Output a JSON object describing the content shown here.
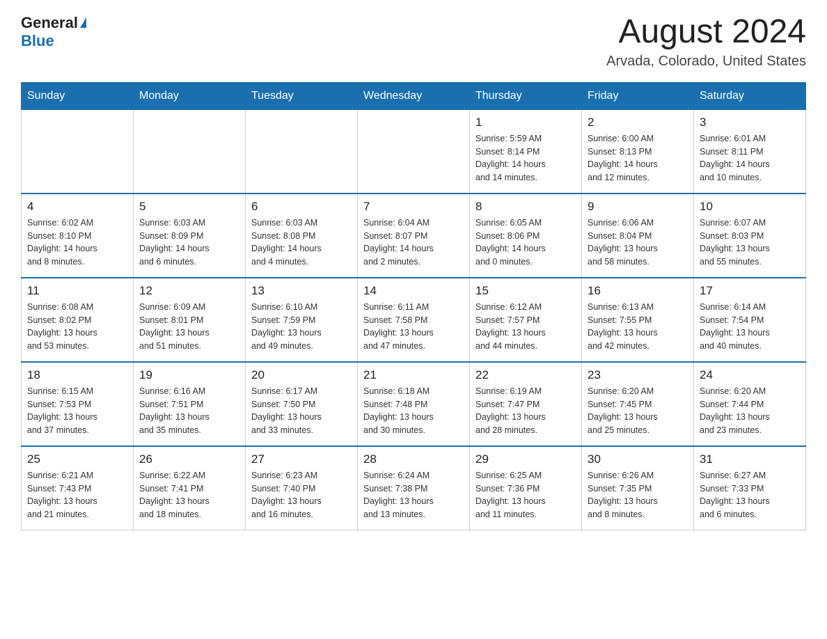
{
  "header": {
    "logo_general": "General",
    "logo_blue": "Blue",
    "month_title": "August 2024",
    "location": "Arvada, Colorado, United States"
  },
  "weekdays": [
    "Sunday",
    "Monday",
    "Tuesday",
    "Wednesday",
    "Thursday",
    "Friday",
    "Saturday"
  ],
  "weeks": [
    [
      {
        "day": "",
        "info": ""
      },
      {
        "day": "",
        "info": ""
      },
      {
        "day": "",
        "info": ""
      },
      {
        "day": "",
        "info": ""
      },
      {
        "day": "1",
        "info": "Sunrise: 5:59 AM\nSunset: 8:14 PM\nDaylight: 14 hours\nand 14 minutes."
      },
      {
        "day": "2",
        "info": "Sunrise: 6:00 AM\nSunset: 8:13 PM\nDaylight: 14 hours\nand 12 minutes."
      },
      {
        "day": "3",
        "info": "Sunrise: 6:01 AM\nSunset: 8:11 PM\nDaylight: 14 hours\nand 10 minutes."
      }
    ],
    [
      {
        "day": "4",
        "info": "Sunrise: 6:02 AM\nSunset: 8:10 PM\nDaylight: 14 hours\nand 8 minutes."
      },
      {
        "day": "5",
        "info": "Sunrise: 6:03 AM\nSunset: 8:09 PM\nDaylight: 14 hours\nand 6 minutes."
      },
      {
        "day": "6",
        "info": "Sunrise: 6:03 AM\nSunset: 8:08 PM\nDaylight: 14 hours\nand 4 minutes."
      },
      {
        "day": "7",
        "info": "Sunrise: 6:04 AM\nSunset: 8:07 PM\nDaylight: 14 hours\nand 2 minutes."
      },
      {
        "day": "8",
        "info": "Sunrise: 6:05 AM\nSunset: 8:06 PM\nDaylight: 14 hours\nand 0 minutes."
      },
      {
        "day": "9",
        "info": "Sunrise: 6:06 AM\nSunset: 8:04 PM\nDaylight: 13 hours\nand 58 minutes."
      },
      {
        "day": "10",
        "info": "Sunrise: 6:07 AM\nSunset: 8:03 PM\nDaylight: 13 hours\nand 55 minutes."
      }
    ],
    [
      {
        "day": "11",
        "info": "Sunrise: 6:08 AM\nSunset: 8:02 PM\nDaylight: 13 hours\nand 53 minutes."
      },
      {
        "day": "12",
        "info": "Sunrise: 6:09 AM\nSunset: 8:01 PM\nDaylight: 13 hours\nand 51 minutes."
      },
      {
        "day": "13",
        "info": "Sunrise: 6:10 AM\nSunset: 7:59 PM\nDaylight: 13 hours\nand 49 minutes."
      },
      {
        "day": "14",
        "info": "Sunrise: 6:11 AM\nSunset: 7:58 PM\nDaylight: 13 hours\nand 47 minutes."
      },
      {
        "day": "15",
        "info": "Sunrise: 6:12 AM\nSunset: 7:57 PM\nDaylight: 13 hours\nand 44 minutes."
      },
      {
        "day": "16",
        "info": "Sunrise: 6:13 AM\nSunset: 7:55 PM\nDaylight: 13 hours\nand 42 minutes."
      },
      {
        "day": "17",
        "info": "Sunrise: 6:14 AM\nSunset: 7:54 PM\nDaylight: 13 hours\nand 40 minutes."
      }
    ],
    [
      {
        "day": "18",
        "info": "Sunrise: 6:15 AM\nSunset: 7:53 PM\nDaylight: 13 hours\nand 37 minutes."
      },
      {
        "day": "19",
        "info": "Sunrise: 6:16 AM\nSunset: 7:51 PM\nDaylight: 13 hours\nand 35 minutes."
      },
      {
        "day": "20",
        "info": "Sunrise: 6:17 AM\nSunset: 7:50 PM\nDaylight: 13 hours\nand 33 minutes."
      },
      {
        "day": "21",
        "info": "Sunrise: 6:18 AM\nSunset: 7:48 PM\nDaylight: 13 hours\nand 30 minutes."
      },
      {
        "day": "22",
        "info": "Sunrise: 6:19 AM\nSunset: 7:47 PM\nDaylight: 13 hours\nand 28 minutes."
      },
      {
        "day": "23",
        "info": "Sunrise: 6:20 AM\nSunset: 7:45 PM\nDaylight: 13 hours\nand 25 minutes."
      },
      {
        "day": "24",
        "info": "Sunrise: 6:20 AM\nSunset: 7:44 PM\nDaylight: 13 hours\nand 23 minutes."
      }
    ],
    [
      {
        "day": "25",
        "info": "Sunrise: 6:21 AM\nSunset: 7:43 PM\nDaylight: 13 hours\nand 21 minutes."
      },
      {
        "day": "26",
        "info": "Sunrise: 6:22 AM\nSunset: 7:41 PM\nDaylight: 13 hours\nand 18 minutes."
      },
      {
        "day": "27",
        "info": "Sunrise: 6:23 AM\nSunset: 7:40 PM\nDaylight: 13 hours\nand 16 minutes."
      },
      {
        "day": "28",
        "info": "Sunrise: 6:24 AM\nSunset: 7:38 PM\nDaylight: 13 hours\nand 13 minutes."
      },
      {
        "day": "29",
        "info": "Sunrise: 6:25 AM\nSunset: 7:36 PM\nDaylight: 13 hours\nand 11 minutes."
      },
      {
        "day": "30",
        "info": "Sunrise: 6:26 AM\nSunset: 7:35 PM\nDaylight: 13 hours\nand 8 minutes."
      },
      {
        "day": "31",
        "info": "Sunrise: 6:27 AM\nSunset: 7:33 PM\nDaylight: 13 hours\nand 6 minutes."
      }
    ]
  ]
}
